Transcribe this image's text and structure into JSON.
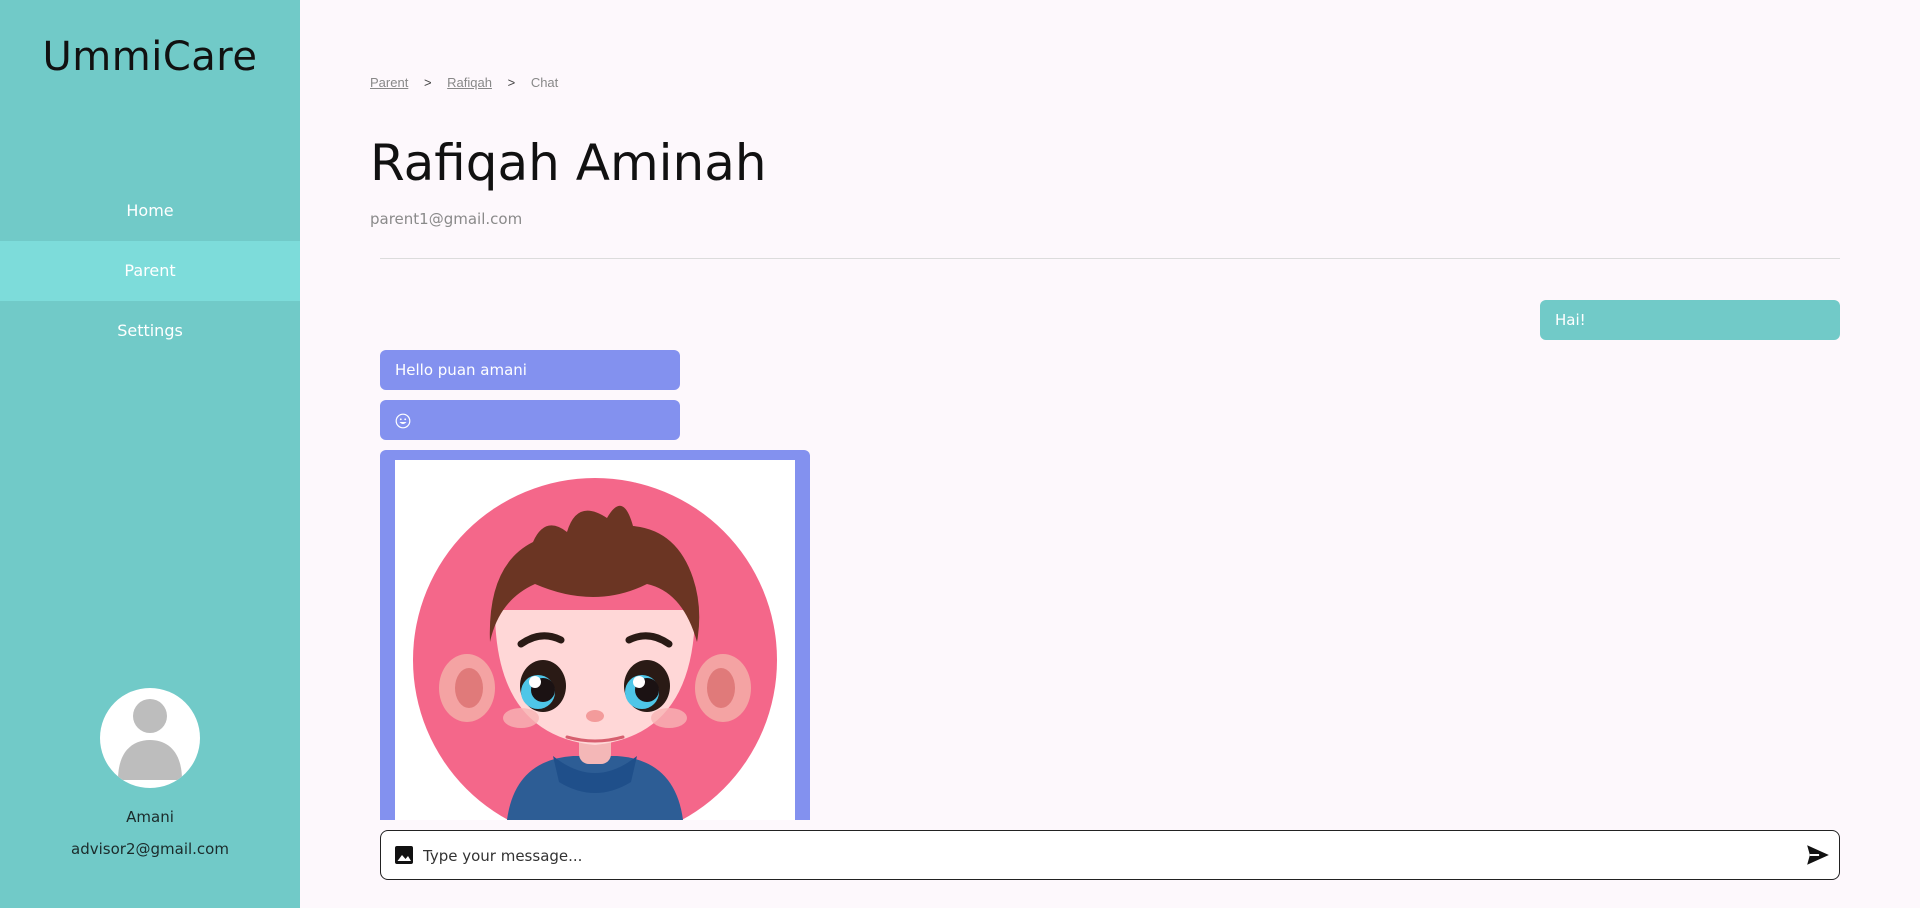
{
  "app": {
    "name": "UmmiCare"
  },
  "sidebar": {
    "items": [
      {
        "label": "Home",
        "active": false
      },
      {
        "label": "Parent",
        "active": true
      },
      {
        "label": "Settings",
        "active": false
      }
    ],
    "user": {
      "name": "Amani",
      "email": "advisor2@gmail.com"
    }
  },
  "breadcrumb": {
    "items": [
      "Parent",
      "Rafiqah",
      "Chat"
    ],
    "separator": ">"
  },
  "header": {
    "title": "Rafiqah Aminah",
    "email": "parent1@gmail.com"
  },
  "messages": [
    {
      "from": "me",
      "text": "Hai!"
    },
    {
      "from": "them",
      "text": "Hello puan amani"
    },
    {
      "from": "them",
      "icon": "smiley-emoji-icon"
    },
    {
      "from": "them",
      "image": "boy-avatar-image"
    }
  ],
  "composer": {
    "placeholder": "Type your message...",
    "value": ""
  },
  "colors": {
    "sidebar": "#71cac8",
    "sidebar_active": "#7ddcda",
    "sent_bubble": "#71cac8",
    "received_bubble": "#8391ef",
    "background": "#fdf8fc"
  }
}
